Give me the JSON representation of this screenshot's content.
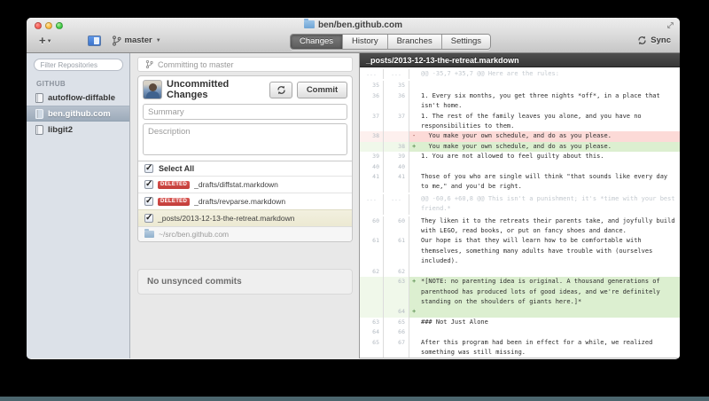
{
  "window": {
    "title": "ben/ben.github.com"
  },
  "toolbar": {
    "branch": "master",
    "tabs": [
      "Changes",
      "History",
      "Branches",
      "Settings"
    ],
    "active_tab": "Changes",
    "sync_label": "Sync"
  },
  "sidebar": {
    "filter_placeholder": "Filter Repositories",
    "section": "GITHUB",
    "repos": [
      {
        "name": "autoflow-diffable",
        "selected": false
      },
      {
        "name": "ben.github.com",
        "selected": true
      },
      {
        "name": "libgit2",
        "selected": false
      }
    ]
  },
  "commit": {
    "committing_to": "Committing to master",
    "header": "Uncommitted Changes",
    "commit_label": "Commit",
    "summary_placeholder": "Summary",
    "description_placeholder": "Description",
    "select_all_label": "Select All",
    "files": [
      {
        "badge": "DELETED",
        "name": "_drafts/diffstat.markdown",
        "checked": true,
        "selected": false
      },
      {
        "badge": "DELETED",
        "name": "_drafts/revparse.markdown",
        "checked": true,
        "selected": false
      },
      {
        "badge": null,
        "name": "_posts/2013-12-13-the-retreat.markdown",
        "checked": true,
        "selected": true
      }
    ],
    "repo_path": "~/src/ben.github.com",
    "no_unsynced": "No unsynced commits"
  },
  "diff": {
    "filename": "_posts/2013-12-13-the-retreat.markdown",
    "rows": [
      {
        "type": "hunk",
        "old": "...",
        "new": "...",
        "marker": "",
        "text": "@@ -35,7 +35,7 @@ Here are the rules:"
      },
      {
        "type": "ctx",
        "old": "35",
        "new": "35",
        "marker": "",
        "text": ""
      },
      {
        "type": "ctx",
        "old": "36",
        "new": "36",
        "marker": "",
        "text": "1. Every six months, you get three nights *off*, in a place that isn't home."
      },
      {
        "type": "ctx",
        "old": "37",
        "new": "37",
        "marker": "",
        "text": "1. The rest of the family leaves you alone, and you have no responsibilities to them."
      },
      {
        "type": "del",
        "old": "38",
        "new": "",
        "marker": "-",
        "text": "  You make your own schedule, and do as you please."
      },
      {
        "type": "add",
        "old": "",
        "new": "38",
        "marker": "+",
        "text": "  You make your own schedule, and do as you please."
      },
      {
        "type": "ctx",
        "old": "39",
        "new": "39",
        "marker": "",
        "text": "1. You are not allowed to feel guilty about this."
      },
      {
        "type": "ctx",
        "old": "40",
        "new": "40",
        "marker": "",
        "text": ""
      },
      {
        "type": "ctx",
        "old": "41",
        "new": "41",
        "marker": "",
        "text": "Those of you who are single will think \"that sounds like every day to me,\" and you'd be right."
      },
      {
        "type": "hunk",
        "old": "...",
        "new": "...",
        "marker": "",
        "text": "@@ -60,6 +60,8 @@ This isn't a punishment; it's *time with your best friend.*"
      },
      {
        "type": "ctx",
        "old": "60",
        "new": "60",
        "marker": "",
        "text": "They liken it to the retreats their parents take, and joyfully build with LEGO, read books, or put on fancy shoes and dance."
      },
      {
        "type": "ctx",
        "old": "61",
        "new": "61",
        "marker": "",
        "text": "Our hope is that they will learn how to be comfortable with themselves, something many adults have trouble with (ourselves included)."
      },
      {
        "type": "ctx",
        "old": "62",
        "new": "62",
        "marker": "",
        "text": ""
      },
      {
        "type": "add",
        "old": "",
        "new": "63",
        "marker": "+",
        "text": "*[NOTE: no parenting idea is original. A thousand generations of parenthood has produced lots of good ideas, and we're definitely standing on the shoulders of giants here.]*"
      },
      {
        "type": "add",
        "old": "",
        "new": "64",
        "marker": "+",
        "text": ""
      },
      {
        "type": "ctx",
        "old": "63",
        "new": "65",
        "marker": "",
        "text": "### Not Just Alone"
      },
      {
        "type": "ctx",
        "old": "64",
        "new": "66",
        "marker": "",
        "text": ""
      },
      {
        "type": "ctx",
        "old": "65",
        "new": "67",
        "marker": "",
        "text": "After this program had been in effect for a while, we realized something was still missing."
      }
    ]
  }
}
